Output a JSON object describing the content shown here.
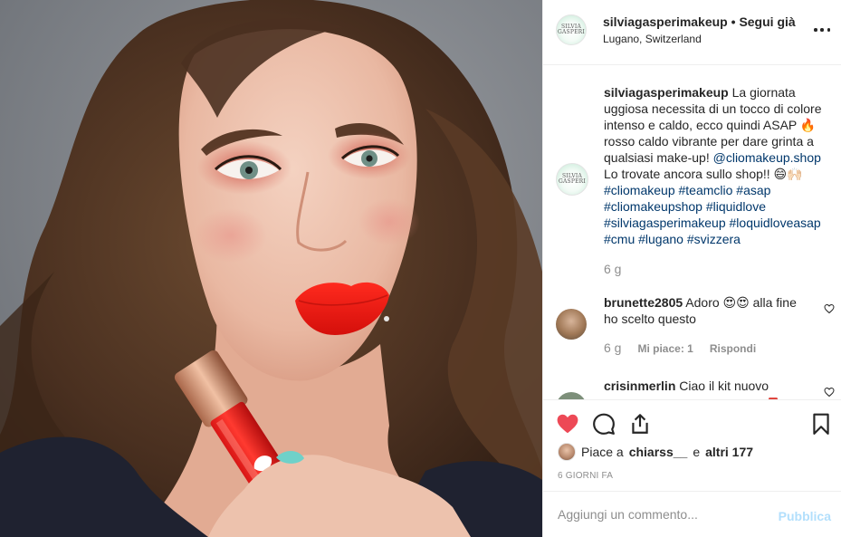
{
  "header": {
    "username": "silviagasperimakeup",
    "separator": " • ",
    "follow_label": "Segui già",
    "location": "Lugano, Switzerland",
    "avatar_logo_line1": "SILVIA",
    "avatar_logo_line2": "GASPERI"
  },
  "caption": {
    "username": "silviagasperimakeup",
    "text_part1": "La giornata uggiosa necessita di un tocco di colore intenso e caldo, ecco quindi ASAP 🔥 rosso caldo vibrante per dare grinta a qualsiasi make-up!",
    "mention": "@cliomakeup.shop",
    "text_part2": "Lo trovate ancora sullo shop!! 😄🙌🏻",
    "hashtags": "#cliomakeup #teamclio #asap #cliomakeupshop #liquidlove #silviagasperimakeup #loquidloveasap #cmu #lugano #svizzera",
    "time": "6 g"
  },
  "comments": [
    {
      "username": "brunette2805",
      "text": "Adoro 😍😍 alla fine ho scelto questo",
      "time": "6 g",
      "likes": "Mi piace: 1",
      "reply": "Rispondi"
    },
    {
      "username": "crisinmerlin",
      "text": "Ciao il kit nuovo"
    }
  ],
  "actions": {
    "like_icon": "heart-icon",
    "comment_icon": "comment-icon",
    "share_icon": "share-icon",
    "save_icon": "bookmark-icon",
    "like_color": "#ed4956"
  },
  "likes": {
    "prefix": "Piace a",
    "user": "chiarss__",
    "middle": "e",
    "others": "altri 177"
  },
  "posted_ago": "6 giorni fa",
  "add_comment": {
    "placeholder": "Aggiungi un commento...",
    "publish_label": "Pubblica"
  }
}
